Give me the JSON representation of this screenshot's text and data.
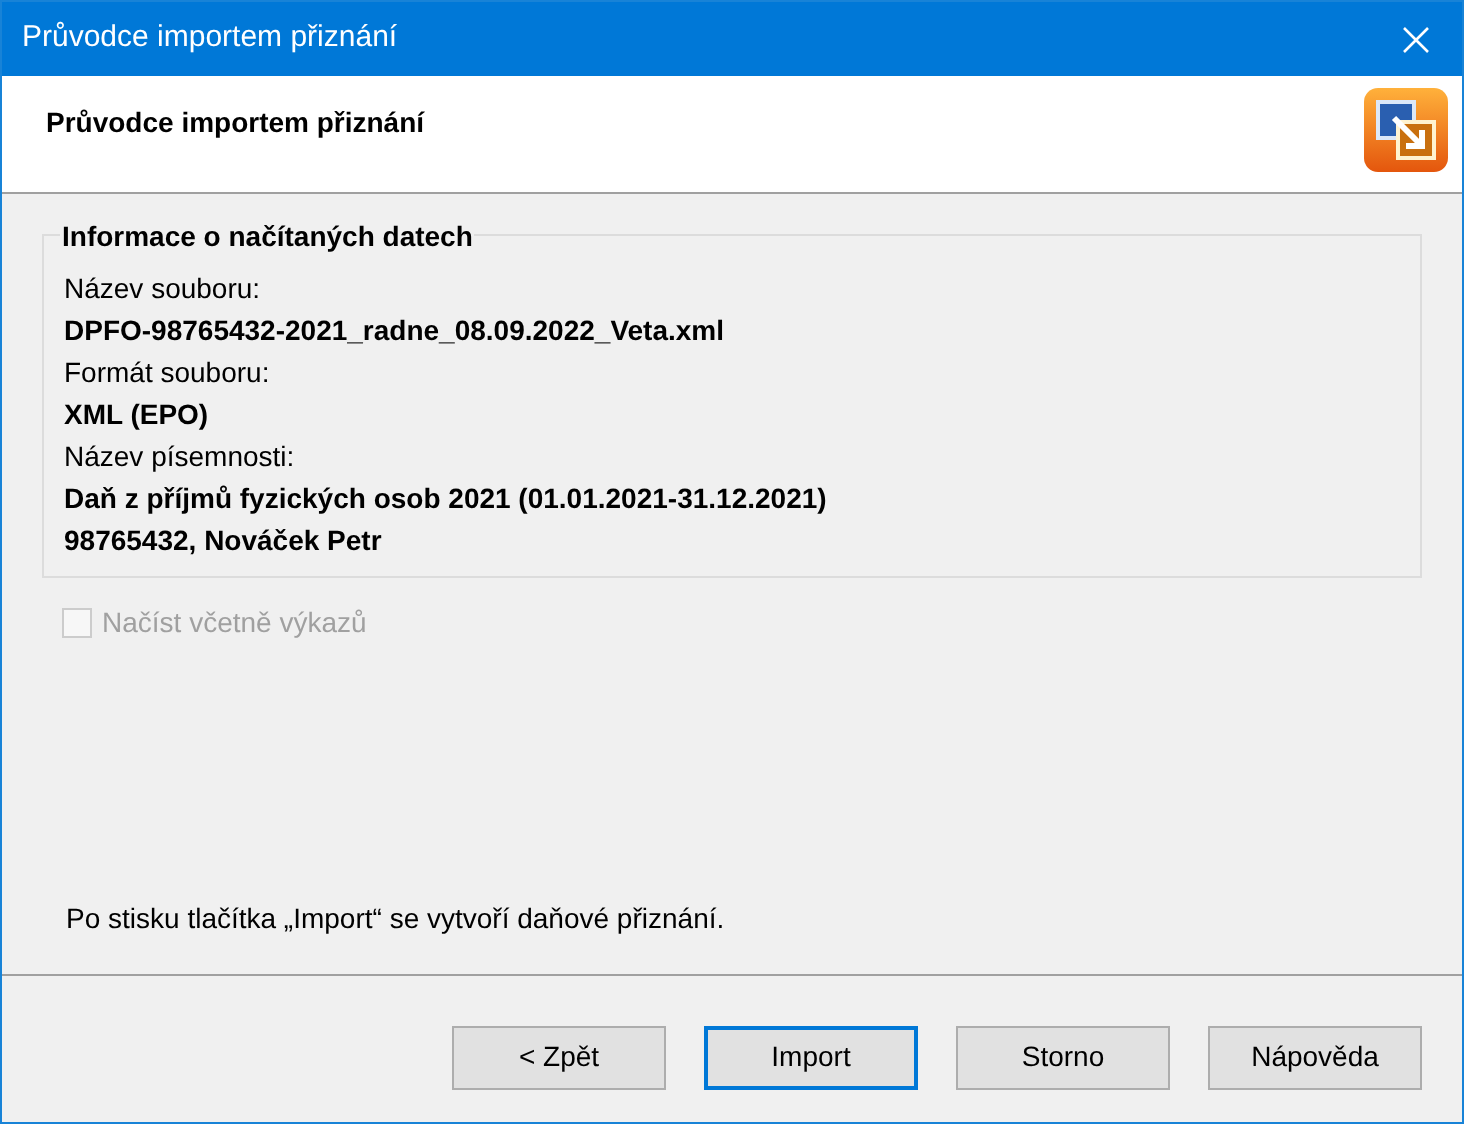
{
  "window": {
    "title": "Průvodce importem přiznání"
  },
  "header": {
    "title": "Průvodce importem přiznání"
  },
  "group": {
    "legend": "Informace o načítaných datech",
    "fields": [
      {
        "label": "Název souboru:",
        "values": [
          "DPFO-98765432-2021_radne_08.09.2022_Veta.xml"
        ]
      },
      {
        "label": "Formát souboru:",
        "values": [
          "XML (EPO)"
        ]
      },
      {
        "label": "Název písemnosti:",
        "values": [
          "Daň z příjmů fyzických osob 2021 (01.01.2021-31.12.2021)",
          "98765432, Nováček Petr"
        ]
      }
    ]
  },
  "checkbox": {
    "label": "Načíst včetně výkazů",
    "checked": false,
    "disabled": true
  },
  "hint": "Po stisku tlačítka „Import“ se vytvoří daňové přiznání.",
  "buttons": [
    {
      "label": "< Zpět",
      "default": false
    },
    {
      "label": "Import",
      "default": true
    },
    {
      "label": "Storno",
      "default": false
    },
    {
      "label": "Nápověda",
      "default": false
    }
  ]
}
